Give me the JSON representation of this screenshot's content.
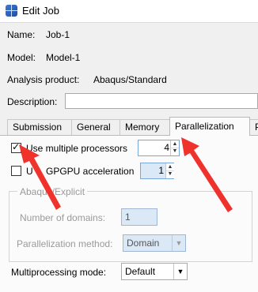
{
  "window": {
    "title": "Edit Job"
  },
  "job": {
    "name_label": "Name:",
    "name_value": "Job-1",
    "model_label": "Model:",
    "model_value": "Model-1",
    "analysis_label": "Analysis product:",
    "analysis_value": "Abaqus/Standard",
    "description_label": "Description:",
    "description_value": ""
  },
  "tabs": [
    {
      "label": "Submission"
    },
    {
      "label": "General"
    },
    {
      "label": "Memory"
    },
    {
      "label": "Parallelization",
      "active": true
    },
    {
      "label": "P"
    }
  ],
  "parallelization": {
    "use_multiple_processors": {
      "label": "Use multiple processors",
      "checked": true,
      "value": "4"
    },
    "gpgpu": {
      "label_start": "U",
      "label_end": "GPGPU acceleration",
      "checked": false,
      "value": "1"
    },
    "explicit_group": {
      "title": "Abaqus/Explicit",
      "domains_label": "Number of domains:",
      "domains_value": "1",
      "method_label": "Parallelization method:",
      "method_value": "Domain"
    },
    "mp_mode": {
      "label": "Multiprocessing mode:",
      "value": "Default"
    }
  },
  "colors": {
    "annotation_arrow": "#f0322d",
    "accent_field": "#dbe8f6"
  },
  "icons": [
    "abaqus-app-icon",
    "check-icon",
    "spin-up-icon",
    "spin-down-icon",
    "chevron-down-icon"
  ]
}
